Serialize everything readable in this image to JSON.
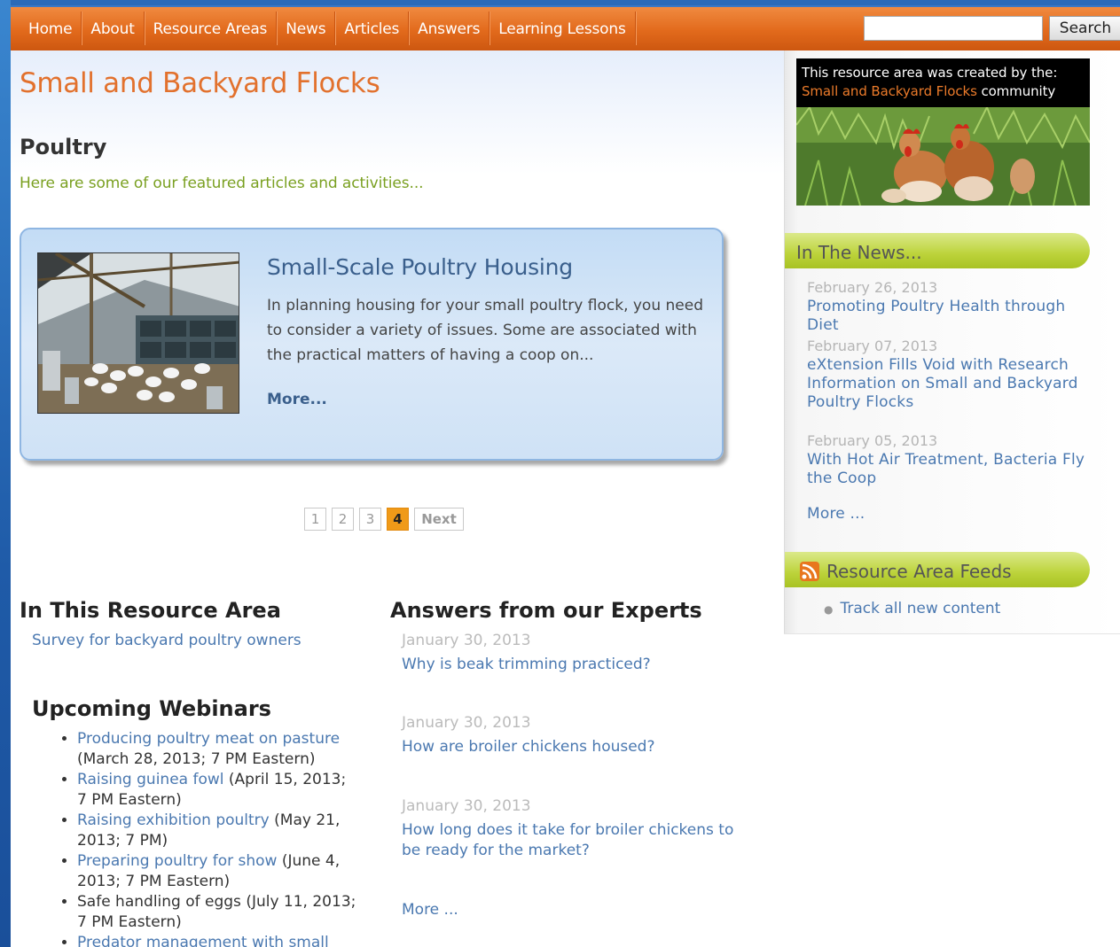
{
  "nav": {
    "items": [
      "Home",
      "About",
      "Resource Areas",
      "News",
      "Articles",
      "Answers",
      "Learning Lessons"
    ],
    "search_button": "Search",
    "search_value": ""
  },
  "site": {
    "title": "Small and Backyard Flocks"
  },
  "section": {
    "title": "Poultry",
    "intro": "Here are some of our featured articles and activities..."
  },
  "featured": {
    "title": "Small-Scale Poultry Housing",
    "description": "In planning housing for your small poultry flock, you need to consider a variety of issues. Some are associated with the practical matters of having a coop on...",
    "more": "More..."
  },
  "pager": {
    "pages": [
      "1",
      "2",
      "3",
      "4"
    ],
    "active": "4",
    "next": "Next"
  },
  "resource_area": {
    "title": "In This Resource Area",
    "links": [
      "Survey for backyard poultry owners"
    ]
  },
  "webinars": {
    "title": "Upcoming Webinars",
    "items": [
      {
        "link": "Producing poultry meat on pasture",
        "text": " (March 28, 2013; 7 PM Eastern)"
      },
      {
        "link": "Raising guinea fowl",
        "text": " (April 15, 2013; 7 PM Eastern)"
      },
      {
        "link": "Raising exhibition poultry",
        "text": " (May 21, 2013; 7 PM)"
      },
      {
        "link": "Preparing poultry for show",
        "text": " (June 4, 2013; 7 PM Eastern)"
      },
      {
        "link": "",
        "text": "Safe handling of eggs (July 11, 2013; 7 PM Eastern)"
      },
      {
        "link": "Predator management with small and",
        "text": ""
      }
    ]
  },
  "answers": {
    "title": "Answers from our Experts",
    "items": [
      {
        "date": "January 30, 2013",
        "question": "Why is beak trimming practiced?"
      },
      {
        "date": "January 30, 2013",
        "question": "How are broiler chickens housed?"
      },
      {
        "date": "January 30, 2013",
        "question": "How long does it take for broiler chickens to be ready for the market?"
      }
    ],
    "more": "More ..."
  },
  "sidebar": {
    "promo_line1": "This resource area was created by the:",
    "promo_link": "Small and Backyard Flocks",
    "promo_suffix": " community",
    "news_title": "In The News...",
    "news": [
      {
        "date": "February 26, 2013",
        "title": "Promoting Poultry Health through Diet"
      },
      {
        "date": "February 07, 2013",
        "title": "eXtension Fills Void with Research Information on Small and Backyard Poultry Flocks"
      },
      {
        "date": "February 05, 2013",
        "title": "With Hot Air Treatment, Bacteria Fly the Coop"
      }
    ],
    "news_more": "More ...",
    "feeds_title": "Resource Area Feeds",
    "feeds": [
      "Track all new content"
    ]
  },
  "colors": {
    "nav_orange": "#e26a1c",
    "title_orange": "#e2712d",
    "intro_green": "#7aa021",
    "link_blue": "#4a78b0",
    "sidebar_header_green": "#bcd33a",
    "pager_active": "#f09a18"
  }
}
